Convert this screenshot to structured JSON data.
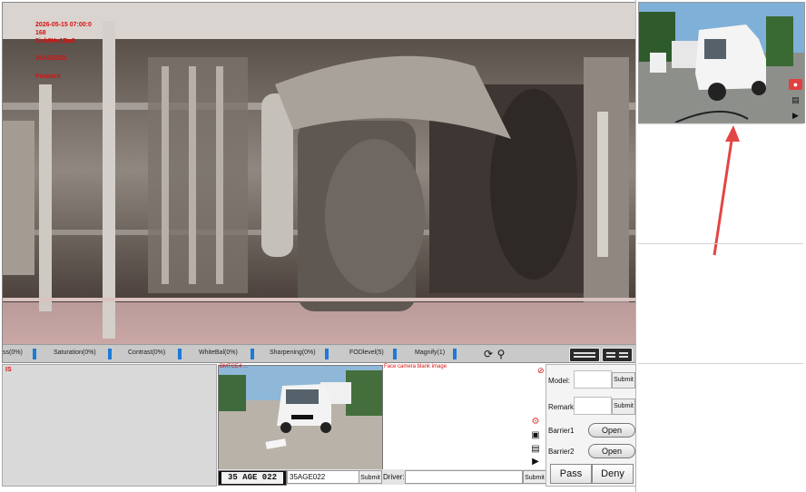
{
  "main_viewer": {
    "overlay": {
      "datetime": "2026-05-15 07:00:0",
      "line2": "168",
      "code": "5ick9Hv1Bu0",
      "plate": "35AGE022",
      "direction": "Forward"
    },
    "sliders": [
      {
        "label": "ss(0%)"
      },
      {
        "label": "Saturation(0%)"
      },
      {
        "label": "Contrast(0%)"
      },
      {
        "label": "WhiteBal(0%)"
      },
      {
        "label": "Sharpening(0%)"
      },
      {
        "label": "FODlevel(5)"
      },
      {
        "label": "Magnify(1)"
      }
    ],
    "icons": {
      "reset": "refresh-icon",
      "search": "magnifier-icon"
    }
  },
  "bottom_left": {
    "label": "IS"
  },
  "front_camera": {
    "caption_left": "BMTCE4 ...",
    "caption_right": "Face camera blank image"
  },
  "plate_row": {
    "plate_crop_text": "35 AGE 022",
    "plate_value": "35AGE022",
    "submit_label": "Submit",
    "driver_label": "Driver:",
    "driver_value": "",
    "driver_submit_label": "Submit"
  },
  "control_panel": {
    "model_label": "Model:",
    "model_value": "",
    "model_submit": "Submit",
    "remark_label": "Remark:",
    "remark_value": "",
    "remark_submit": "Submit",
    "barrier1_label": "Barrier1",
    "barrier1_button": "Open",
    "barrier2_label": "Barrier2",
    "barrier2_button": "Open",
    "pass_label": "Pass",
    "deny_label": "Deny"
  },
  "colors": {
    "overlay_red": "#d81010",
    "slider_knob": "#1e7ad6",
    "arrow": "#e34545"
  }
}
